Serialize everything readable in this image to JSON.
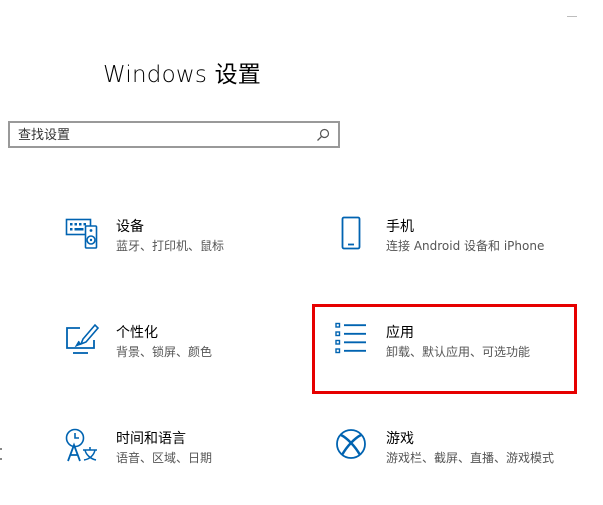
{
  "window": {
    "title": "Windows 设置"
  },
  "search": {
    "placeholder": "查找设置",
    "value": ""
  },
  "tiles": [
    {
      "id": "devices",
      "icon": "keyboard-speaker-icon",
      "title": "设备",
      "desc": "蓝牙、打印机、鼠标"
    },
    {
      "id": "phone",
      "icon": "phone-icon",
      "title": "手机",
      "desc": "连接 Android 设备和 iPhone"
    },
    {
      "id": "personalization",
      "icon": "brush-screen-icon",
      "title": "个性化",
      "desc": "背景、锁屏、颜色"
    },
    {
      "id": "apps",
      "icon": "apps-list-icon",
      "title": "应用",
      "desc": "卸载、默认应用、可选功能"
    },
    {
      "id": "time-language",
      "icon": "time-language-icon",
      "title": "时间和语言",
      "desc": "语音、区域、日期"
    },
    {
      "id": "gaming",
      "icon": "xbox-icon",
      "title": "游戏",
      "desc": "游戏栏、截屏、直播、游戏模式"
    }
  ],
  "colors": {
    "accent": "#0063b1",
    "highlight": "#e60000"
  }
}
